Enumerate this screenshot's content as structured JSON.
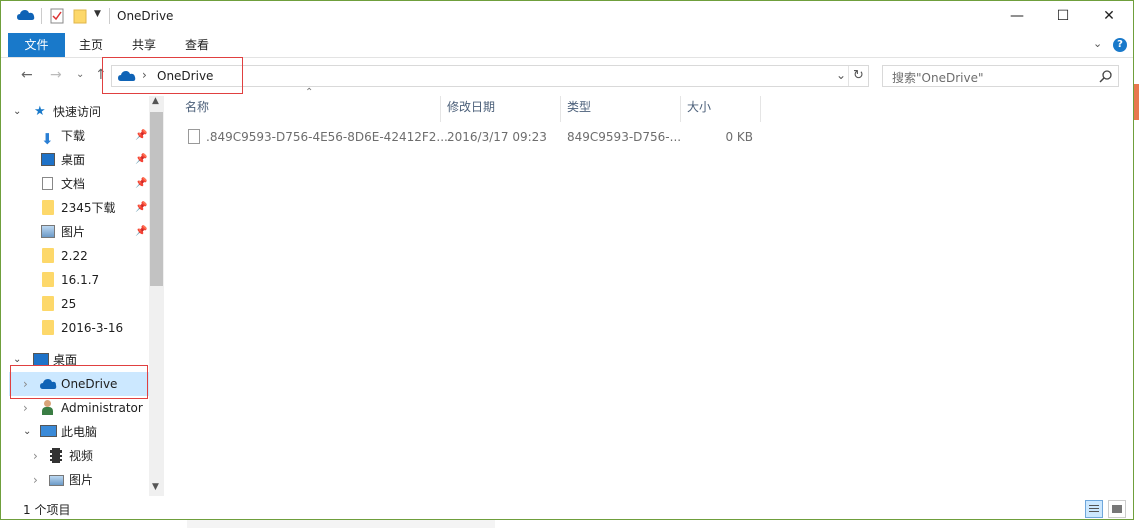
{
  "window": {
    "title": "OneDrive",
    "controls": {
      "minimize": "—",
      "maximize": "☐",
      "close": "✕"
    }
  },
  "ribbon": {
    "tabs": [
      "文件",
      "主页",
      "共享",
      "查看"
    ]
  },
  "address": {
    "path": "OneDrive",
    "separator": "›",
    "dropdown": "⌄",
    "refresh": "↻"
  },
  "search": {
    "placeholder": "搜索\"OneDrive\""
  },
  "nav": {
    "quick_access": "快速访问",
    "items": [
      {
        "label": "下载",
        "pinned": true
      },
      {
        "label": "桌面",
        "pinned": true
      },
      {
        "label": "文档",
        "pinned": true
      },
      {
        "label": "2345下载",
        "pinned": true
      },
      {
        "label": "图片",
        "pinned": true
      },
      {
        "label": "2.22"
      },
      {
        "label": "16.1.7"
      },
      {
        "label": "25"
      },
      {
        "label": "2016-3-16"
      }
    ],
    "desktop": "桌面",
    "onedrive": "OneDrive",
    "administrator": "Administrator",
    "this_pc": "此电脑",
    "videos": "视频",
    "pictures": "图片"
  },
  "columns": {
    "name": "名称",
    "modified": "修改日期",
    "type": "类型",
    "size": "大小"
  },
  "files": [
    {
      "name": ".849C9593-D756-4E56-8D6E-42412F2...",
      "modified": "2016/3/17 09:23",
      "type": "849C9593-D756-...",
      "size": "0 KB"
    }
  ],
  "status": {
    "count": "1 个项目"
  }
}
